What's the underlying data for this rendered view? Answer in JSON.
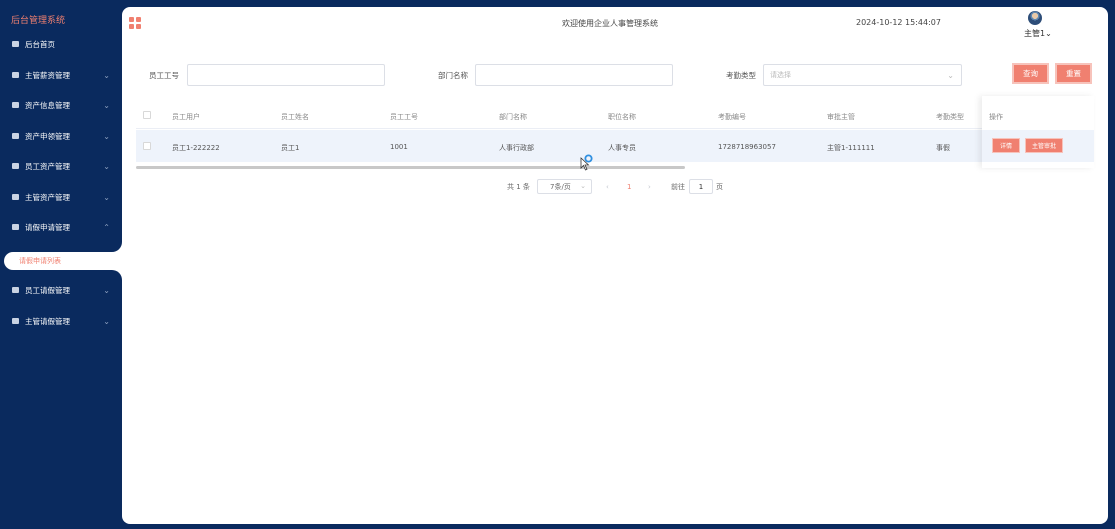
{
  "sidebar": {
    "brand": "后台管理系统",
    "items": [
      {
        "label": "后台首页",
        "chevron": ""
      },
      {
        "label": "主管薪资管理",
        "chevron": "⌄"
      },
      {
        "label": "资产信息管理",
        "chevron": "⌄"
      },
      {
        "label": "资产申领管理",
        "chevron": "⌄"
      },
      {
        "label": "员工资产管理",
        "chevron": "⌄"
      },
      {
        "label": "主管资产管理",
        "chevron": "⌄"
      },
      {
        "label": "请假申请管理",
        "chevron": "⌃"
      },
      {
        "label": "员工请假管理",
        "chevron": "⌄"
      },
      {
        "label": "主管请假管理",
        "chevron": "⌄"
      }
    ],
    "active_sub": "请假申请列表"
  },
  "header": {
    "title": "欢迎使用企业人事管理系统",
    "datetime": "2024-10-12 15:44:07",
    "user": "主管1⌄"
  },
  "search": {
    "employee_id_label": "员工工号",
    "employee_id_value": "",
    "dept_label": "部门名称",
    "dept_value": "",
    "attendance_type_label": "考勤类型",
    "attendance_type_placeholder": "请选择",
    "query_button": "查询",
    "reset_button": "重置"
  },
  "table": {
    "columns": [
      "员工用户",
      "员工姓名",
      "员工工号",
      "部门名称",
      "职位名称",
      "考勤编号",
      "审批主管",
      "考勤类型",
      "操作"
    ],
    "rows": [
      {
        "user": "员工1-222222",
        "name": "员工1",
        "emp_no": "1001",
        "dept": "人事行政部",
        "position": "人事专员",
        "attendance_no": "1728718963057",
        "approver": "主管1-111111",
        "type": "事假",
        "actions": [
          "详情",
          "主管审批"
        ]
      }
    ]
  },
  "pagination": {
    "total": "共 1 条",
    "page_size": "7条/页",
    "prev": "‹",
    "current": "1",
    "next": "›",
    "goto_label": "前往",
    "goto_value": "1",
    "page_suffix": "页"
  },
  "colors": {
    "sidebar_bg": "#0a2a5e",
    "accent": "#f08070",
    "row_highlight": "#eef3fb"
  }
}
